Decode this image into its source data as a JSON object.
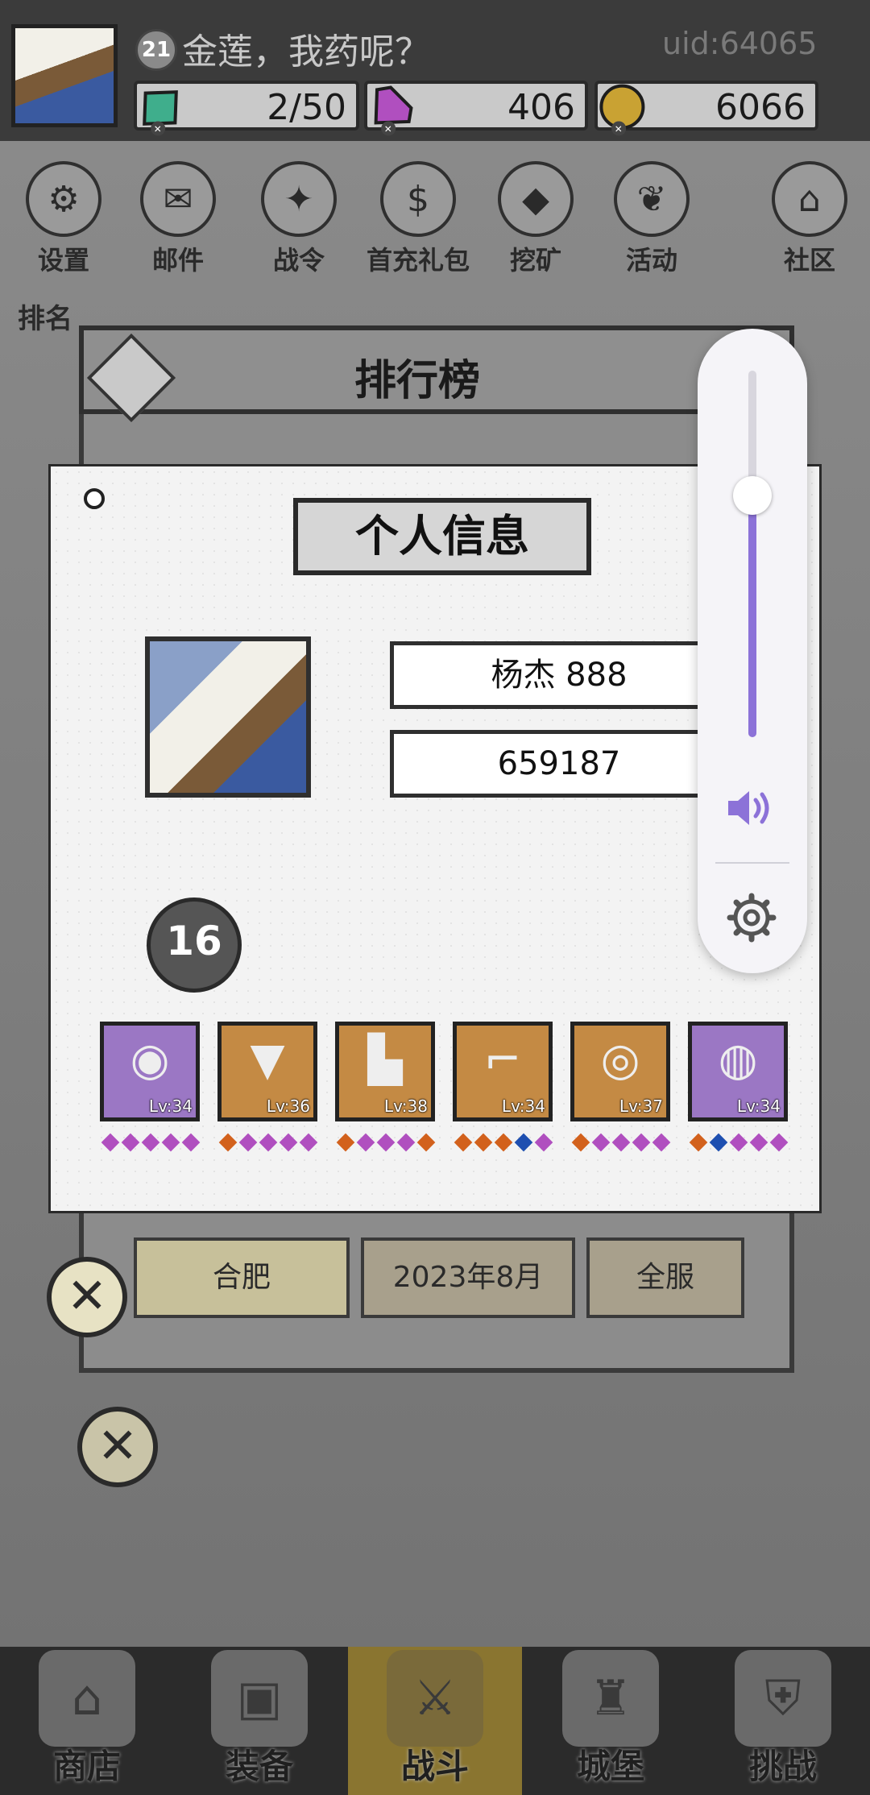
{
  "header": {
    "level": "21",
    "title": "金莲，我药呢？",
    "uid": "uid:64065",
    "resources": [
      {
        "name": "energy",
        "value": "2/50",
        "icon": "green-gem-icon",
        "color": "#3fae8c"
      },
      {
        "name": "diamond",
        "value": "406",
        "icon": "purple-diamond-icon",
        "color": "#b04fbf"
      },
      {
        "name": "gold",
        "value": "6066",
        "icon": "gold-coin-icon",
        "color": "#c9a233"
      }
    ]
  },
  "menu": [
    {
      "label": "设置",
      "icon": "gear-icon"
    },
    {
      "label": "邮件",
      "icon": "envelope-icon"
    },
    {
      "label": "战令",
      "icon": "crystal-ball-icon"
    },
    {
      "label": "首充礼包",
      "icon": "money-bag-icon"
    },
    {
      "label": "挖矿",
      "icon": "ore-icon"
    },
    {
      "label": "活动",
      "icon": "wreath-icon"
    },
    {
      "label": "社区",
      "icon": "home-icon"
    }
  ],
  "side_label": "排名",
  "ranking": {
    "title": "排行榜",
    "filters": [
      "合肥",
      "2023年8月",
      "全服"
    ]
  },
  "dialog": {
    "title": "个人信息",
    "name": "杨杰  888",
    "power": "659187",
    "rank_level": "16",
    "equipment": [
      {
        "level": "Lv:34",
        "glyph": "◉",
        "slot_color": "#9b77c4",
        "gems": [
          "#b04fbf",
          "#b04fbf",
          "#b04fbf",
          "#b04fbf",
          "#b04fbf"
        ]
      },
      {
        "level": "Lv:36",
        "glyph": "▼",
        "slot_color": "#c48a44",
        "gems": [
          "#d2611c",
          "#b04fbf",
          "#b04fbf",
          "#b04fbf",
          "#b04fbf"
        ]
      },
      {
        "level": "Lv:38",
        "glyph": "▙",
        "slot_color": "#c48a44",
        "gems": [
          "#d2611c",
          "#b04fbf",
          "#b04fbf",
          "#b04fbf",
          "#d2611c"
        ]
      },
      {
        "level": "Lv:34",
        "glyph": "⌐",
        "slot_color": "#c48a44",
        "gems": [
          "#d2611c",
          "#d2611c",
          "#d2611c",
          "#1e4fb0",
          "#b04fbf"
        ]
      },
      {
        "level": "Lv:37",
        "glyph": "◎",
        "slot_color": "#c48a44",
        "gems": [
          "#d2611c",
          "#b04fbf",
          "#b04fbf",
          "#b04fbf",
          "#b04fbf"
        ]
      },
      {
        "level": "Lv:34",
        "glyph": "◍",
        "slot_color": "#9b77c4",
        "gems": [
          "#d2611c",
          "#1e4fb0",
          "#b04fbf",
          "#b04fbf",
          "#b04fbf"
        ]
      }
    ]
  },
  "volume": {
    "level": 0.66,
    "accent": "#8c72d8"
  },
  "bottom_nav": [
    {
      "label": "商店",
      "icon": "shop-icon"
    },
    {
      "label": "装备",
      "icon": "backpack-icon"
    },
    {
      "label": "战斗",
      "icon": "crossed-swords-icon",
      "active": true
    },
    {
      "label": "城堡",
      "icon": "castle-icon"
    },
    {
      "label": "挑战",
      "icon": "shield-icon"
    }
  ]
}
